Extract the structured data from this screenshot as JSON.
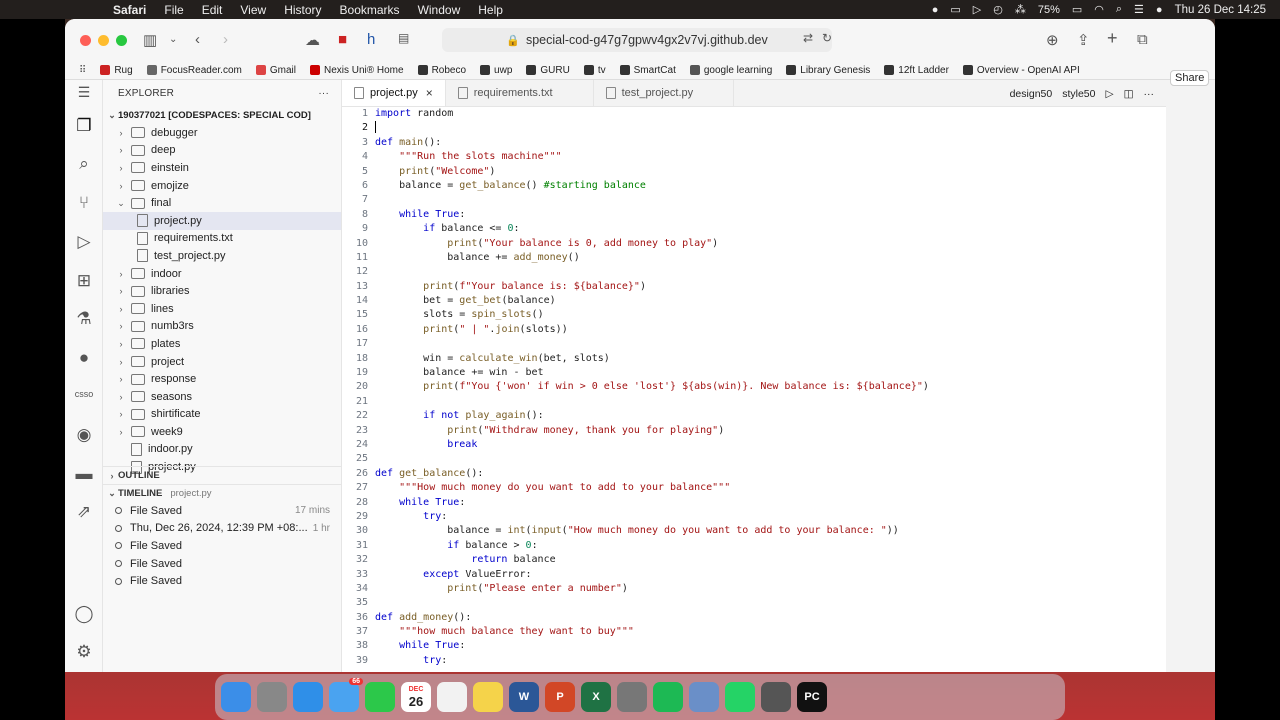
{
  "menubar": {
    "app": "Safari",
    "items": [
      "File",
      "Edit",
      "View",
      "History",
      "Bookmarks",
      "Window",
      "Help"
    ],
    "battery": "75%",
    "datetime": "Thu 26 Dec  14:25"
  },
  "browser": {
    "url": "special-cod-g47g7gpwv4gx2v7vj.github.dev",
    "bookmarks": [
      {
        "label": "Rug",
        "color": "#c22"
      },
      {
        "label": "FocusReader.com",
        "color": "#666"
      },
      {
        "label": "Gmail",
        "color": "#d44"
      },
      {
        "label": "Nexis Uni® Home",
        "color": "#c00"
      },
      {
        "label": "Robeco",
        "color": "#333"
      },
      {
        "label": "uwp",
        "color": "#333"
      },
      {
        "label": "GURU",
        "color": "#333"
      },
      {
        "label": "tv",
        "color": "#333"
      },
      {
        "label": "SmartCat",
        "color": "#333"
      },
      {
        "label": "google learning",
        "color": "#555"
      },
      {
        "label": "Library Genesis",
        "color": "#333"
      },
      {
        "label": "12ft Ladder",
        "color": "#333"
      },
      {
        "label": "Overview - OpenAI API",
        "color": "#333"
      }
    ],
    "share_label": "Share"
  },
  "explorer": {
    "title": "EXPLORER",
    "root": "190377021 [CODESPACES: SPECIAL COD]",
    "items": [
      {
        "label": "debugger",
        "type": "folder",
        "indent": 1,
        "open": false
      },
      {
        "label": "deep",
        "type": "folder",
        "indent": 1,
        "open": false
      },
      {
        "label": "einstein",
        "type": "folder",
        "indent": 1,
        "open": false
      },
      {
        "label": "emojize",
        "type": "folder",
        "indent": 1,
        "open": false
      },
      {
        "label": "final",
        "type": "folder",
        "indent": 1,
        "open": true
      },
      {
        "label": "project.py",
        "type": "file",
        "indent": 2,
        "selected": true
      },
      {
        "label": "requirements.txt",
        "type": "file",
        "indent": 2
      },
      {
        "label": "test_project.py",
        "type": "file",
        "indent": 2
      },
      {
        "label": "indoor",
        "type": "folder",
        "indent": 1,
        "open": false
      },
      {
        "label": "libraries",
        "type": "folder",
        "indent": 1,
        "open": false
      },
      {
        "label": "lines",
        "type": "folder",
        "indent": 1,
        "open": false
      },
      {
        "label": "numb3rs",
        "type": "folder",
        "indent": 1,
        "open": false
      },
      {
        "label": "plates",
        "type": "folder",
        "indent": 1,
        "open": false
      },
      {
        "label": "project",
        "type": "folder",
        "indent": 1,
        "open": false
      },
      {
        "label": "response",
        "type": "folder",
        "indent": 1,
        "open": false
      },
      {
        "label": "seasons",
        "type": "folder",
        "indent": 1,
        "open": false
      },
      {
        "label": "shirtificate",
        "type": "folder",
        "indent": 1,
        "open": false
      },
      {
        "label": "week9",
        "type": "folder",
        "indent": 1,
        "open": false
      },
      {
        "label": "indoor.py",
        "type": "file",
        "indent": 1
      },
      {
        "label": "project.py",
        "type": "file",
        "indent": 1
      }
    ],
    "outline_label": "OUTLINE",
    "timeline_label": "TIMELINE",
    "timeline_file": "project.py",
    "timeline": [
      {
        "label": "File Saved",
        "time": "17 mins"
      },
      {
        "label": "Thu, Dec 26, 2024, 12:39 PM +08:...",
        "time": "1 hr"
      },
      {
        "label": "File Saved",
        "time": ""
      },
      {
        "label": "File Saved",
        "time": ""
      },
      {
        "label": "File Saved",
        "time": ""
      }
    ]
  },
  "tabs": [
    {
      "label": "project.py",
      "active": true
    },
    {
      "label": "requirements.txt",
      "active": false
    },
    {
      "label": "test_project.py",
      "active": false
    }
  ],
  "tab_actions": {
    "design": "design50",
    "style": "style50"
  },
  "activity": [
    "files-icon",
    "search-icon",
    "source-control-icon",
    "run-debug-icon",
    "extensions-icon",
    "testing-icon",
    "github-icon",
    "csso-icon",
    "duck-icon",
    "docker-icon",
    "remote-icon",
    "account-icon",
    "settings-icon"
  ],
  "activity_csso": "csso",
  "code_lines": [
    "import random",
    "",
    "def main():",
    "    \"\"\"Run the slots machine\"\"\"",
    "    print(\"Welcome\")",
    "    balance = get_balance() #starting balance",
    "",
    "    while True:",
    "        if balance <= 0:",
    "            print(\"Your balance is 0, add money to play\")",
    "            balance += add_money()",
    "",
    "        print(f\"Your balance is: ${balance}\")",
    "        bet = get_bet(balance)",
    "        slots = spin_slots()",
    "        print(\" | \".join(slots))",
    "",
    "        win = calculate_win(bet, slots)",
    "        balance += win - bet",
    "        print(f\"You {'won' if win > 0 else 'lost'} ${abs(win)}. New balance is: ${balance}\")",
    "",
    "        if not play_again():",
    "            print(\"Withdraw money, thank you for playing\")",
    "            break",
    "",
    "def get_balance():",
    "    \"\"\"How much money do you want to add to your balance\"\"\"",
    "    while True:",
    "        try:",
    "            balance = int(input(\"How much money do you want to add to your balance: \"))",
    "            if balance > 0:",
    "                return balance",
    "        except ValueError:",
    "            print(\"Please enter a number\")",
    "",
    "def add_money():",
    "    \"\"\"how much balance they want to buy\"\"\"",
    "    while True:",
    "        try:"
  ],
  "cursor_line": 2,
  "dock": [
    {
      "name": "finder",
      "color": "#3b8ee8"
    },
    {
      "name": "launchpad",
      "color": "#888"
    },
    {
      "name": "safari",
      "color": "#2f8fe8"
    },
    {
      "name": "mail",
      "color": "#4aa3f0"
    },
    {
      "name": "facetime",
      "color": "#2cc84a"
    },
    {
      "name": "calendar",
      "color": "#fff"
    },
    {
      "name": "reminders",
      "color": "#f2f2f2"
    },
    {
      "name": "notes",
      "color": "#f5d34a"
    },
    {
      "name": "word",
      "color": "#2b5797"
    },
    {
      "name": "powerpoint",
      "color": "#d24726"
    },
    {
      "name": "excel",
      "color": "#1f7244"
    },
    {
      "name": "settings",
      "color": "#777"
    },
    {
      "name": "spotify",
      "color": "#1db954"
    },
    {
      "name": "preview",
      "color": "#6a8fc8"
    },
    {
      "name": "whatsapp",
      "color": "#25d366"
    },
    {
      "name": "iphone-mirroring",
      "color": "#555"
    },
    {
      "name": "pycharm",
      "color": "#111"
    }
  ],
  "dock_calendar_month": "DEC",
  "dock_calendar_day": "26",
  "dock_mail_badge": "66"
}
